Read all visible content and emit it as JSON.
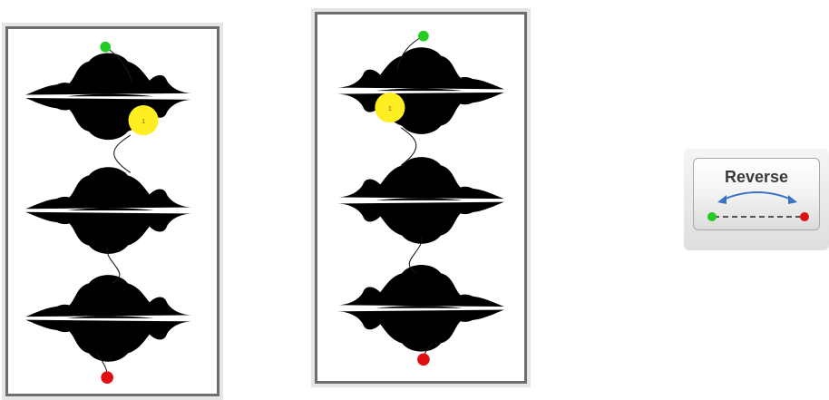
{
  "panels": [
    {
      "id": "left",
      "step_label": "1"
    },
    {
      "id": "right",
      "step_label": "1"
    }
  ],
  "reverse_button": {
    "label": "Reverse"
  },
  "colors": {
    "start_marker": "#22cc22",
    "end_marker": "#e01010",
    "step_marker": "#ffee22",
    "panel_border": "#6e6e6e",
    "arrow": "#3b73c4"
  }
}
